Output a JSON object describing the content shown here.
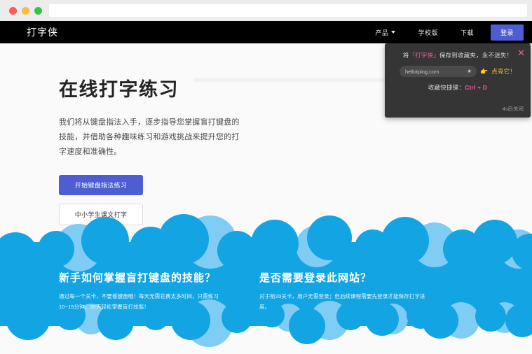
{
  "browser": {
    "lights": [
      "close",
      "minimize",
      "maximize"
    ],
    "url_value": ""
  },
  "nav": {
    "logo": "打字侠",
    "items": [
      {
        "label": "产品",
        "has_chevron": true
      },
      {
        "label": "学校版",
        "has_chevron": false
      },
      {
        "label": "下载",
        "has_chevron": false
      }
    ],
    "login_label": "登录"
  },
  "hero": {
    "title": "在线打字练习",
    "paragraph": "我们将从键盘指法入手，逐步指导您掌握盲打键盘的技能，并借助各种趣味练习和游戏挑战来提升您的打字速度和准确性。",
    "primary_button": "开始键盘指法练习",
    "secondary_button": "中小学生课文打字"
  },
  "popup": {
    "title_prefix": "将",
    "title_brand": "「打字侠」",
    "title_suffix": "保存到收藏夹，永不迷失！",
    "close_icon": "✕",
    "url_text": "hellotping.com",
    "star_icon": "★",
    "hand_icon": "👉",
    "hand_text": "点亮它！",
    "shortcut_label": "收藏快捷键：",
    "shortcut_key": "Ctrl + D",
    "timer": "4s后关闭"
  },
  "clouds": {
    "color_main": "#13a5e3",
    "color_light": "#7fcdf5",
    "background": "#fafafa"
  },
  "features": [
    {
      "title": "新手如何掌握盲打键盘的技能？",
      "body": "通过每一个关卡，不要看键盘哦！每天无需花费太多时间，只需练习10~15分钟，30天轻松掌握盲打技能！"
    },
    {
      "title": "是否需要登录此网站？",
      "body": "对于前20关卡，用户无需登录；但后续课程需要先登录才能保存打字进度。"
    }
  ]
}
